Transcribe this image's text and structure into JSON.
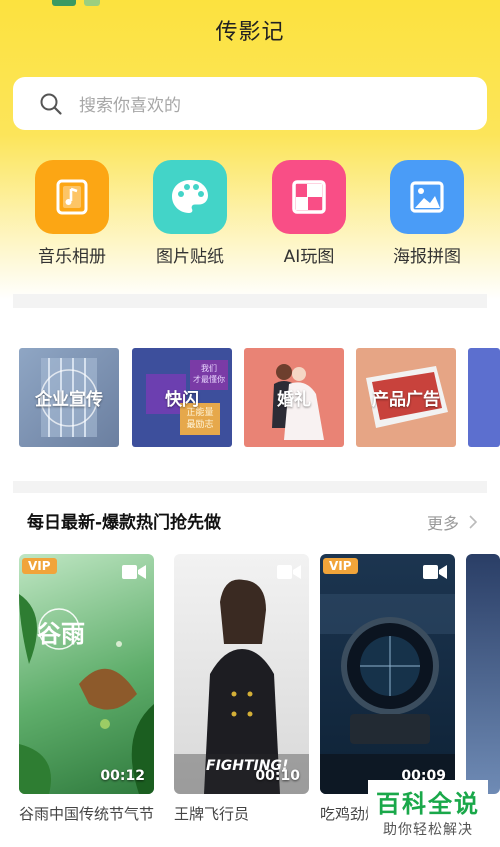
{
  "app": {
    "title": "传影记"
  },
  "search": {
    "placeholder": "搜索你喜欢的",
    "icon": "search-icon"
  },
  "features": [
    {
      "label": "音乐相册",
      "icon": "music-album-icon",
      "color": "#fca614"
    },
    {
      "label": "图片贴纸",
      "icon": "palette-icon",
      "color": "#43d4c8"
    },
    {
      "label": "AI玩图",
      "icon": "ai-collage-icon",
      "color": "#f94e86"
    },
    {
      "label": "海报拼图",
      "icon": "image-poster-icon",
      "color": "#4a9cf7"
    }
  ],
  "categories": [
    {
      "label": "企业宣传",
      "color": "#7b91b0"
    },
    {
      "label": "快闪",
      "color": "#3d4f9c",
      "thumb_text": [
        "我们",
        "才最懂你",
        "正能量",
        "最励志"
      ]
    },
    {
      "label": "婚礼",
      "color": "#e98375"
    },
    {
      "label": "产品广告",
      "color": "#e09a7a"
    }
  ],
  "section": {
    "title": "每日最新-爆款热门抢先做",
    "more": "更多"
  },
  "videos": [
    {
      "title": "谷雨中国传统节气节",
      "duration": "00:12",
      "vip": "VIP",
      "thumb_text": "谷雨"
    },
    {
      "title": "王牌飞行员",
      "duration": "00:10",
      "vip": "",
      "thumb_text": "FIGHTING!"
    },
    {
      "title": "吃鸡劲爆",
      "duration": "00:09",
      "vip": "VIP"
    }
  ],
  "watermark": {
    "title": "百科全说",
    "subtitle": "助你轻松解决"
  }
}
